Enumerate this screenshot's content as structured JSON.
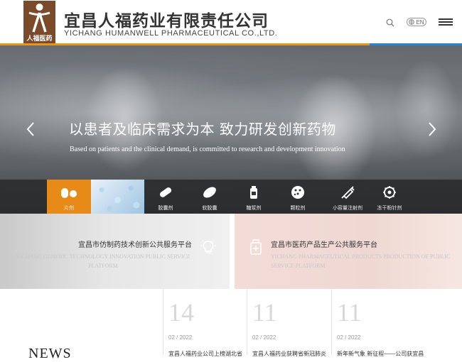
{
  "header": {
    "logo_sub": "人福医药",
    "brand_cn": "宜昌人福药业有限责任公司",
    "brand_en": "YICHANG HUMANWELL PHARMACEUTICAL CO.,LTD.",
    "lang": "EN",
    "icons": [
      "search-icon",
      "globe-icon",
      "menu-icon"
    ]
  },
  "banner": {
    "title": "以患者及临床需求为本 致力研发创新药物",
    "subtitle": "Based on patients and the clinical demand, is committed to research and development innovation"
  },
  "products": [
    {
      "label": "片剂",
      "icon": "tablet-icon",
      "active": true
    },
    {
      "label": "胶囊剂",
      "icon": "capsule-icon"
    },
    {
      "label": "软胶囊",
      "icon": "softgel-icon"
    },
    {
      "label": "糖浆剂",
      "icon": "syrup-bottle-icon"
    },
    {
      "label": "颗粒剂",
      "icon": "granules-icon"
    },
    {
      "label": "小容量注射剂",
      "icon": "syringe-icon"
    },
    {
      "label": "冻干粉针剂",
      "icon": "powder-injection-icon"
    }
  ],
  "platforms": [
    {
      "title": "宜昌市仿制药技术创新公共服务平台",
      "en": "YICHANG GENERIC TECHNOLOGY INNOVATION PUBLIC SERVICE PLATFORM",
      "icon": "lightbulb-icon"
    },
    {
      "title": "宜昌市医药产品生产公共服务平台",
      "en": "YICHANG PHARMACEUTICAL PRODUCTS PRODUCTION OF PUBLIC SERVICE PLATFORM",
      "icon": "medicine-bottle-icon"
    }
  ],
  "news": {
    "heading": "NEWS",
    "items": [
      {
        "day": "14",
        "date": "02 / 2022",
        "title": "宜昌人福药业公司上榜湖北省"
      },
      {
        "day": "11",
        "date": "02 / 2022",
        "title": "宜昌人福药业获聘省新冠肺炎"
      },
      {
        "day": "11",
        "date": "02 / 2022",
        "title": "新年新气象 新征程——公司获宜昌"
      }
    ]
  },
  "colors": {
    "accent_orange": "#e88a18",
    "accent_blue": "#2b82d6",
    "logo_brown": "#7a4a2a"
  }
}
